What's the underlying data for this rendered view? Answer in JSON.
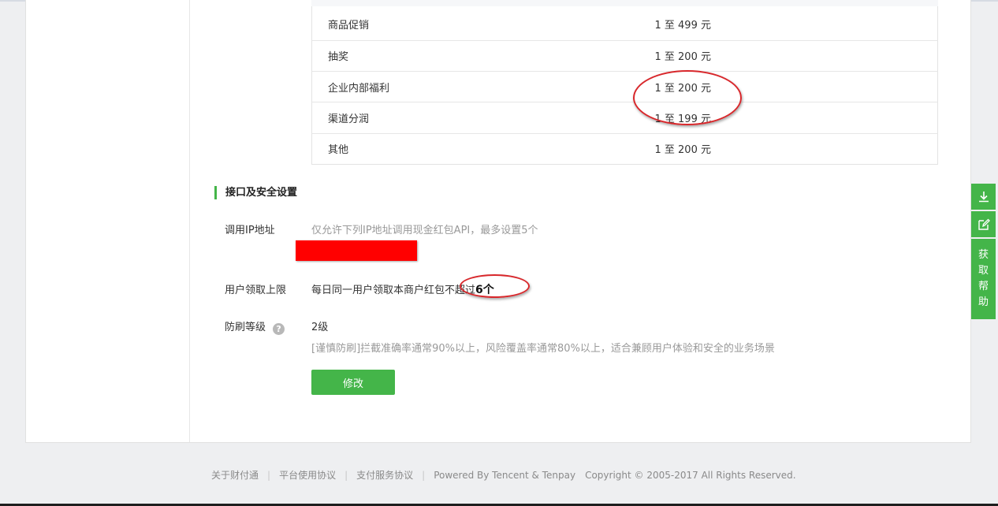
{
  "reward_table": {
    "rows": [
      {
        "name": "商品促销",
        "range": "1 至 499 元"
      },
      {
        "name": "抽奖",
        "range": "1 至 200 元"
      },
      {
        "name": "企业内部福利",
        "range": "1 至 200 元"
      },
      {
        "name": "渠道分润",
        "range": "1 至 199 元"
      },
      {
        "name": "其他",
        "range": "1 至 200 元"
      }
    ]
  },
  "security": {
    "title": "接口及安全设置",
    "ip_label": "调用IP地址",
    "ip_hint": "仅允许下列IP地址调用现金红包API，最多设置5个",
    "limit_label": "用户领取上限",
    "limit_text": "每日同一用户领取本商户红包不超过",
    "limit_count": "6个",
    "antispam_label": "防刷等级",
    "antispam_help": "?",
    "antispam_level": "2级",
    "antispam_desc": "[谨慎防刷]拦截准确率通常90%以上，风险覆盖率通常80%以上，适合兼顾用户体验和安全的业务场景",
    "modify_button": "修改"
  },
  "footer": {
    "links": [
      "关于财付通",
      "平台使用协议",
      "支付服务协议"
    ],
    "powered": "Powered By Tencent & Tenpay",
    "copyright": "Copyright © 2005-2017 All Rights Reserved."
  },
  "side_bar": {
    "download_icon": "download-icon",
    "edit_icon": "edit-icon",
    "help_chars": [
      "获",
      "取",
      "帮",
      "助"
    ],
    "color": "#44b549"
  },
  "colors": {
    "accent": "#44b549",
    "annotation": "#d8272b",
    "redaction": "#ff0000"
  }
}
